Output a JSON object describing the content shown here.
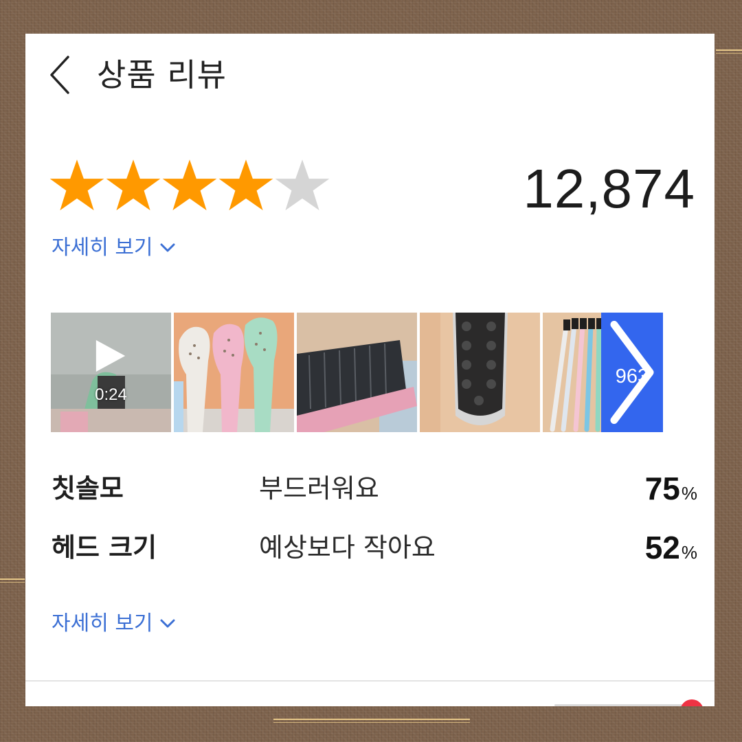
{
  "header": {
    "title": "상품 리뷰",
    "back_icon": "chevron-left-icon"
  },
  "rating": {
    "stars_filled": 4,
    "stars_total": 5,
    "star_color": "#ff9900",
    "star_empty_color": "#d5d5d5",
    "review_count": "12,874"
  },
  "details_link_top": {
    "label": "자세히 보기"
  },
  "gallery": {
    "video_duration": "0:24",
    "more_count": "963",
    "more_color": "#3366ee",
    "thumbnails": [
      "video-toothbrush-thumbnail",
      "pastel-toothbrushes-photo",
      "bristles-closeup-photo",
      "bristle-head-topview-photo",
      "toothbrush-set-photo"
    ]
  },
  "attributes": [
    {
      "label": "칫솔모",
      "value": "부드러워요",
      "percent": "75",
      "percent_sign": "%"
    },
    {
      "label": "헤드 크기",
      "value": "예상보다 작아요",
      "percent": "52",
      "percent_sign": "%"
    }
  ],
  "details_link_bottom": {
    "label": "자세히 보기"
  },
  "colors": {
    "link": "#3b6fd4",
    "text": "#222222"
  }
}
